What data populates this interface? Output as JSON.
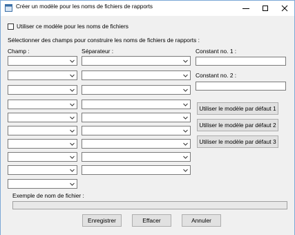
{
  "window": {
    "title": "Créer un modèle pour les noms de fichiers de rapports",
    "minimize_icon": "minimize-icon",
    "maximize_icon": "maximize-icon",
    "close_icon": "close-icon"
  },
  "form": {
    "use_template_label": "Utiliser ce modèle pour les noms de fichiers",
    "use_template_checked": false,
    "instructions": "Sélectionner des champs pour construire les noms de fichiers de rapports :",
    "field_header": "Champ :",
    "separator_header": "Séparateur :",
    "constant1_label": "Constant no. 1 :",
    "constant1_value": "",
    "constant2_label": "Constant no. 2 :",
    "constant2_value": "",
    "field_rows": [
      "",
      "",
      "",
      "",
      "",
      "",
      "",
      "",
      "",
      ""
    ],
    "separator_rows": [
      "",
      "",
      "",
      "",
      "",
      "",
      "",
      "",
      ""
    ],
    "default_buttons": [
      "Utiliser le modèle par défaut 1",
      "Utiliser le modèle par défaut 2",
      "Utiliser le modèle par défaut 3"
    ],
    "example_label": "Exemple de nom de fichier :",
    "example_value": "",
    "save_label": "Enregistrer",
    "clear_label": "Effacer",
    "cancel_label": "Annuler"
  }
}
